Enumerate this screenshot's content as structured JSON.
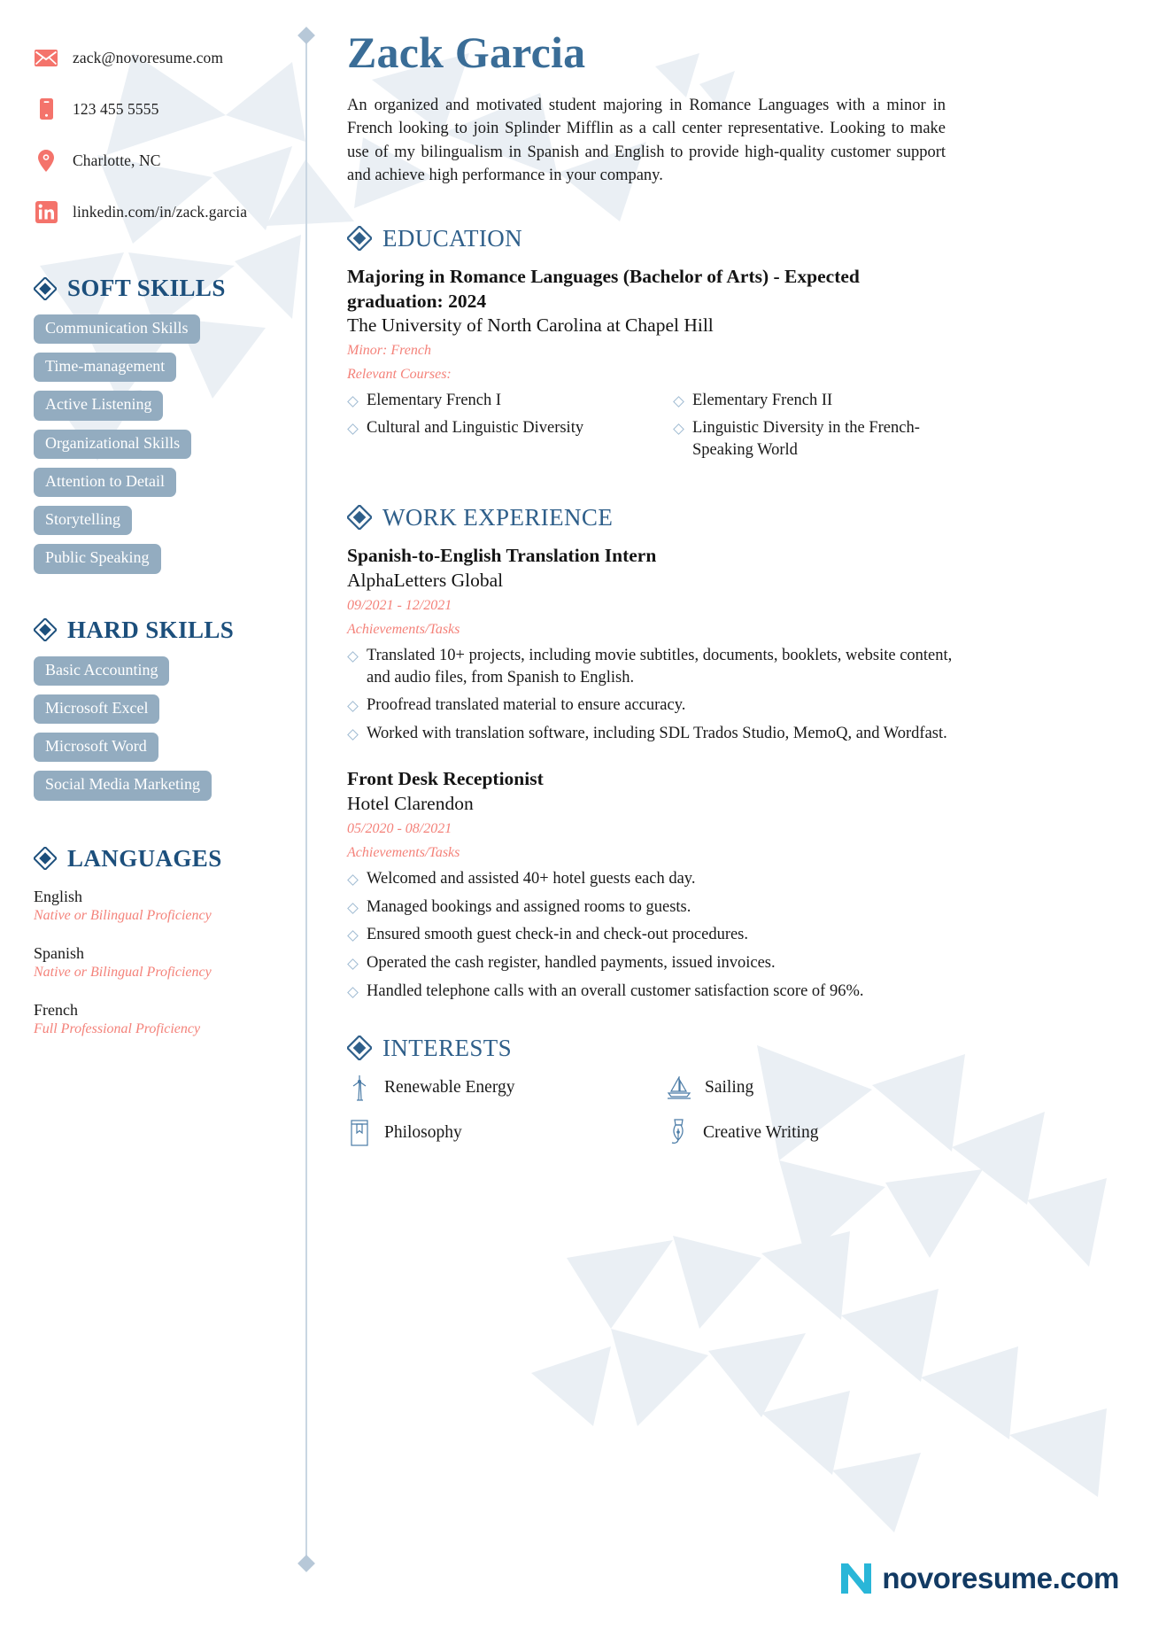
{
  "colors": {
    "accent_blue": "#3a6d97",
    "section_blue": "#2f5f8a",
    "pill_bg": "#93acc0",
    "coral": "#f4827a",
    "icon_red": "#f4736b",
    "bullet_blue": "#9fbbd2",
    "divider": "#c9d6e2",
    "poly": "#eaeff4",
    "logo_navy": "#123a63",
    "logo_cyan": "#29b6d8"
  },
  "contact": {
    "items": [
      {
        "icon": "envelope-icon",
        "text": "zack@novoresume.com"
      },
      {
        "icon": "phone-icon",
        "text": "123 455 5555"
      },
      {
        "icon": "location-pin-icon",
        "text": "Charlotte, NC"
      },
      {
        "icon": "linkedin-icon",
        "text": "linkedin.com/in/zack.garcia"
      }
    ]
  },
  "soft_skills": {
    "heading": "SOFT SKILLS",
    "items": [
      "Communication Skills",
      "Time-management",
      "Active Listening",
      "Organizational Skills",
      "Attention to Detail",
      "Storytelling",
      "Public Speaking"
    ]
  },
  "hard_skills": {
    "heading": "HARD SKILLS",
    "items": [
      "Basic Accounting",
      "Microsoft Excel",
      "Microsoft Word",
      "Social Media Marketing"
    ]
  },
  "languages": {
    "heading": "LANGUAGES",
    "items": [
      {
        "name": "English",
        "level": "Native or Bilingual Proficiency"
      },
      {
        "name": "Spanish",
        "level": "Native or Bilingual Proficiency"
      },
      {
        "name": "French",
        "level": "Full Professional Proficiency"
      }
    ]
  },
  "header": {
    "name": "Zack Garcia",
    "summary": "An organized and motivated student majoring in Romance Languages with a minor in French looking to join Splinder Mifflin as a call center representative. Looking to make use of my bilingualism in Spanish and English to provide high-quality customer support and achieve high performance in your company."
  },
  "education": {
    "heading": "EDUCATION",
    "degree": "Majoring in Romance Languages (Bachelor of Arts) - Expected graduation: 2024",
    "school": "The University of North Carolina at Chapel Hill",
    "minor": "Minor: French",
    "courses_label": "Relevant Courses:",
    "courses_left": [
      "Elementary French I",
      "Cultural and Linguistic Diversity"
    ],
    "courses_right": [
      "Elementary French II",
      "Linguistic Diversity in the French-Speaking World"
    ]
  },
  "work_experience": {
    "heading": "WORK EXPERIENCE",
    "jobs": [
      {
        "title": "Spanish-to-English Translation Intern",
        "company": "AlphaLetters Global",
        "dates": "09/2021 - 12/2021",
        "tasks_label": "Achievements/Tasks",
        "tasks": [
          "Translated 10+ projects, including movie subtitles, documents, booklets, website content, and audio files, from Spanish to English.",
          "Proofread translated material to ensure accuracy.",
          "Worked with translation software, including SDL Trados Studio, MemoQ, and Wordfast."
        ]
      },
      {
        "title": "Front Desk Receptionist",
        "company": "Hotel Clarendon",
        "dates": "05/2020 - 08/2021",
        "tasks_label": "Achievements/Tasks",
        "tasks": [
          "Welcomed and assisted 40+ hotel guests each day.",
          "Managed bookings and assigned rooms to guests.",
          "Ensured smooth guest check-in and check-out procedures.",
          "Operated the cash register, handled payments, issued invoices.",
          "Handled telephone calls with an overall customer satisfaction score of 96%."
        ]
      }
    ]
  },
  "interests": {
    "heading": "INTERESTS",
    "items": [
      {
        "icon": "wind-turbine-icon",
        "label": "Renewable Energy"
      },
      {
        "icon": "sailboat-icon",
        "label": "Sailing"
      },
      {
        "icon": "book-icon",
        "label": "Philosophy"
      },
      {
        "icon": "fountain-pen-nib-icon",
        "label": "Creative Writing"
      }
    ]
  },
  "footer": {
    "logo_mark": "N",
    "logo_text": "novoresume.com"
  }
}
